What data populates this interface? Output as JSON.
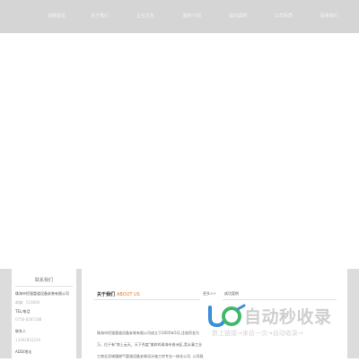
{
  "nav": {
    "items": [
      "创赚首页",
      "关于我们",
      "企业文化",
      "服务介绍",
      "成功案例",
      "公司资质",
      "联系我们"
    ]
  },
  "sidebar": {
    "title": "联系我们",
    "lines": [
      {
        "text": "珠海市恒强管道设备安装有限公司",
        "style": "dark"
      },
      {
        "text": "邮编：519000",
        "style": "light"
      },
      {
        "text": "TEL/电话",
        "style": "dark"
      },
      {
        "text": "0756-6287288",
        "style": "light"
      },
      {
        "text": "联系人",
        "style": "dark"
      },
      {
        "text": "13392852229",
        "style": "light"
      },
      {
        "text": "ADD/地址",
        "style": "dark"
      }
    ]
  },
  "main": {
    "title_cn": "关于我们",
    "title_en": "ABOUT US",
    "more": "更多>>",
    "tab": "成功案例",
    "about_lines": [
      "珠海市恒强管道设备安装有限公司成立于2005年5月,注册资金为",
      "万，位于有\"南上云天，天下秀度\"美称的珠海市香洲区,是从事工业",
      "工商业及城镇燃气管道设备安装设计施工的专业一体化公司. 公司既"
    ]
  },
  "watermark": {
    "text": "自动秒收录",
    "subtitle": "数上链接→来访一次→自动收录→",
    "colors": {
      "blue": "#3a8fd6",
      "green": "#43b86b"
    }
  }
}
